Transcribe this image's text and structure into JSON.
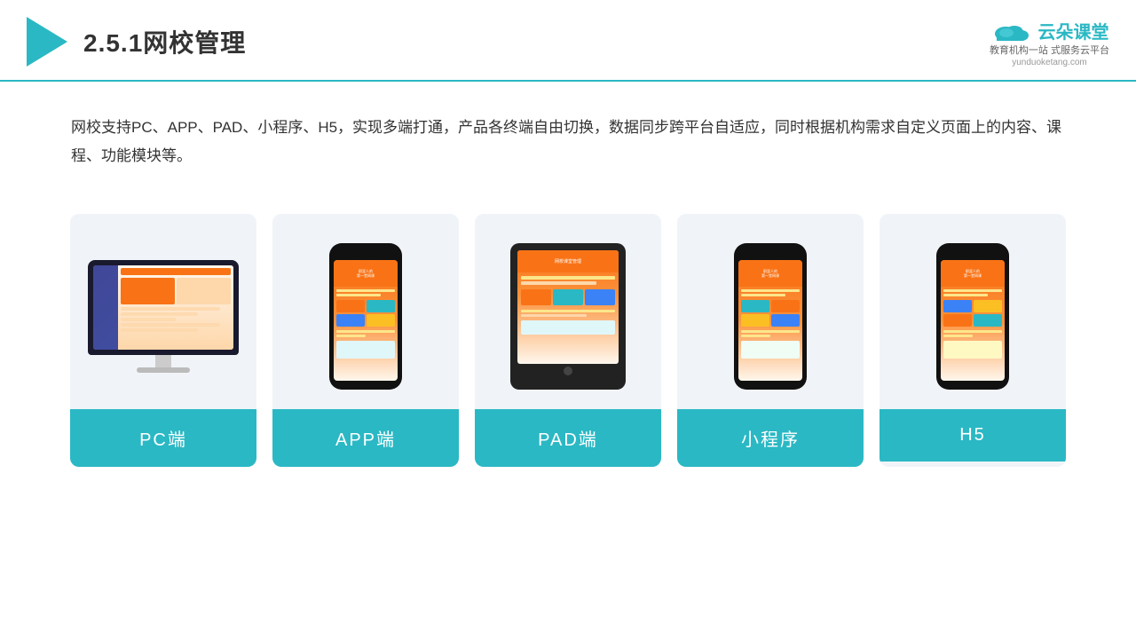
{
  "header": {
    "title": "2.5.1网校管理",
    "logo_name": "云朵课堂",
    "logo_url": "yunduoketang.com",
    "logo_tagline": "教育机构一站\n式服务云平台"
  },
  "description": {
    "text": "网校支持PC、APP、PAD、小程序、H5，实现多端打通，产品各终端自由切换，数据同步跨平台自适应，同时根据机构需求自定义页面上的内容、课程、功能模块等。"
  },
  "cards": [
    {
      "id": "pc",
      "label": "PC端"
    },
    {
      "id": "app",
      "label": "APP端"
    },
    {
      "id": "pad",
      "label": "PAD端"
    },
    {
      "id": "miniprogram",
      "label": "小程序"
    },
    {
      "id": "h5",
      "label": "H5"
    }
  ],
  "colors": {
    "accent": "#2ab8c4",
    "card_bg": "#f0f4f8",
    "text_primary": "#333333"
  }
}
